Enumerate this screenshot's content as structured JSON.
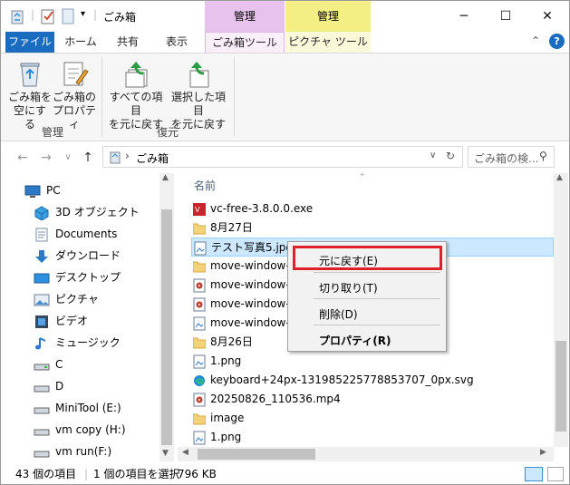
{
  "window": {
    "title": "ごみ箱",
    "context_tab_manage_1": "管理",
    "context_tab_manage_2": "管理",
    "minimize": "─",
    "maximize": "☐",
    "close": "✕"
  },
  "tabs": {
    "file": "ファイル",
    "home": "ホーム",
    "share": "共有",
    "view": "表示",
    "recycle_tools": "ごみ箱ツール",
    "picture_tools": "ピクチャ ツール"
  },
  "ribbon": {
    "empty_bin_l1": "ごみ箱を",
    "empty_bin_l2": "空にする",
    "properties_l1": "ごみ箱の",
    "properties_l2": "プロパティ",
    "group_manage": "管理",
    "restore_all_l1": "すべての項目",
    "restore_all_l2": "を元に戻す",
    "restore_sel_l1": "選択した項目",
    "restore_sel_l2": "を元に戻す",
    "group_restore": "復元"
  },
  "address": {
    "path": "ごみ箱",
    "separator": "›",
    "search_placeholder": "ごみ箱の検..."
  },
  "nav": [
    {
      "label": "PC",
      "icon": "pc-icon"
    },
    {
      "label": "3D オブジェクト",
      "icon": "3d-objects-icon"
    },
    {
      "label": "Documents",
      "icon": "documents-icon"
    },
    {
      "label": "ダウンロード",
      "icon": "download-icon"
    },
    {
      "label": "デスクトップ",
      "icon": "desktop-icon"
    },
    {
      "label": "ピクチャ",
      "icon": "pictures-icon"
    },
    {
      "label": "ビデオ",
      "icon": "video-icon"
    },
    {
      "label": "ミュージック",
      "icon": "music-icon"
    },
    {
      "label": "C",
      "icon": "drive-icon"
    },
    {
      "label": "D",
      "icon": "drive-icon"
    },
    {
      "label": "MiniTool (E:)",
      "icon": "drive-icon"
    },
    {
      "label": "vm copy (H:)",
      "icon": "drive-icon"
    },
    {
      "label": "vm run(F:)",
      "icon": "drive-icon"
    }
  ],
  "content": {
    "column_name": "名前",
    "files": [
      {
        "name": "vc-free-3.8.0.0.exe",
        "icon": "exe-icon"
      },
      {
        "name": "8月27日",
        "icon": "folder-icon"
      },
      {
        "name": "テスト写真5.jpg",
        "icon": "image-file-icon"
      },
      {
        "name": "move-window-w",
        "icon": "folder-icon"
      },
      {
        "name": "move-window-w",
        "icon": "video-file-icon"
      },
      {
        "name": "move-window-w",
        "icon": "video-file-icon"
      },
      {
        "name": "move-window-w",
        "icon": "image-file-icon"
      },
      {
        "name": "8月26日",
        "icon": "folder-icon"
      },
      {
        "name": "1.png",
        "icon": "image-file-icon"
      },
      {
        "name": "keyboard+24px-131985225778853707_0px.svg",
        "icon": "edge-svg-icon"
      },
      {
        "name": "20250826_110536.mp4",
        "icon": "video-file-icon"
      },
      {
        "name": "image",
        "icon": "folder-icon"
      },
      {
        "name": "1.png",
        "icon": "image-file-icon"
      }
    ]
  },
  "context_menu": {
    "restore": "元に戻す(E)",
    "cut": "切り取り(T)",
    "delete": "削除(D)",
    "properties": "プロパティ(R)"
  },
  "status": {
    "item_count": "43 個の項目",
    "selection": "1 個の項目を選択",
    "size": "796 KB"
  },
  "colors": {
    "file_tab": "#1a6cc1",
    "context_manage_pink": "#e7c2ec",
    "context_manage_yellow": "#f3ef85",
    "selection": "#cce8ff",
    "highlight_box": "#e0202a"
  }
}
